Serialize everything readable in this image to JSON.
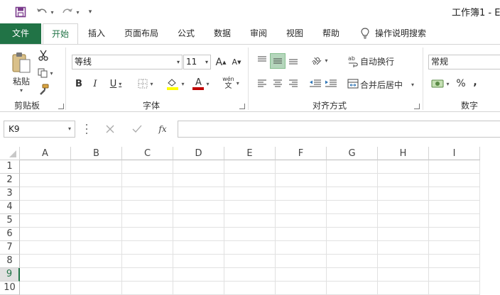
{
  "window": {
    "title": "工作簿1 - E"
  },
  "quick_access": {
    "save_icon": "save-icon",
    "undo_icon": "undo-icon",
    "redo_icon": "redo-icon",
    "customize_icon": "customize-icon"
  },
  "tabs": [
    {
      "label": "文件"
    },
    {
      "label": "开始"
    },
    {
      "label": "插入"
    },
    {
      "label": "页面布局"
    },
    {
      "label": "公式"
    },
    {
      "label": "数据"
    },
    {
      "label": "审阅"
    },
    {
      "label": "视图"
    },
    {
      "label": "帮助"
    }
  ],
  "tell_me": {
    "label": "操作说明搜索"
  },
  "ribbon": {
    "clipboard": {
      "paste_label": "粘贴",
      "group_label": "剪贴板"
    },
    "font": {
      "font_name": "等线",
      "font_size": "11",
      "group_label": "字体",
      "wen_top": "wén",
      "wen_bottom": "文"
    },
    "alignment": {
      "wrap_label": "自动换行",
      "merge_label": "合并后居中",
      "group_label": "对齐方式"
    },
    "number": {
      "format": "常规",
      "percent": "%",
      "comma": ",",
      "group_label": "数字"
    }
  },
  "formula_bar": {
    "name_box": "K9",
    "fx": "fx",
    "value": ""
  },
  "grid": {
    "columns": [
      "A",
      "B",
      "C",
      "D",
      "E",
      "F",
      "G",
      "H",
      "I"
    ],
    "rows": [
      "1",
      "2",
      "3",
      "4",
      "5",
      "6",
      "7",
      "8",
      "9",
      "10"
    ],
    "active_row": "9"
  },
  "colors": {
    "accent": "#217346",
    "fill_highlight": "#ffff00",
    "font_red": "#c00000"
  }
}
